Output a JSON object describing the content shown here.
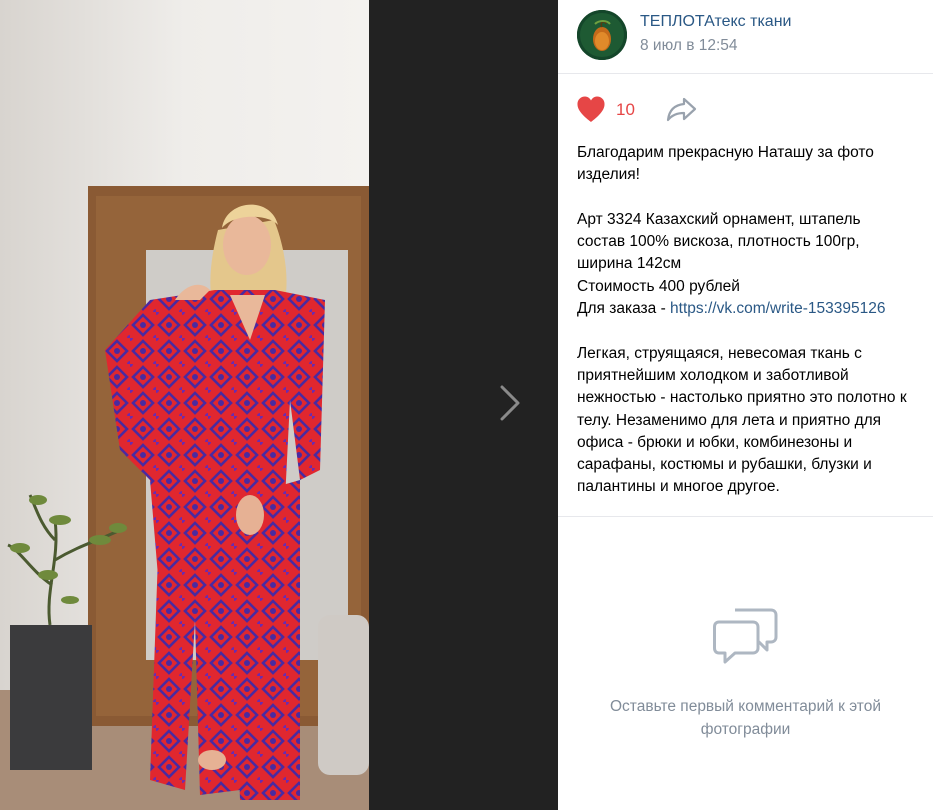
{
  "post": {
    "author": "ТЕПЛОТАтекс ткани",
    "date": "8 июл в 12:54",
    "likes": "10",
    "paragraphs": [
      [
        "Благодарим прекрасную Наташу за фото изделия!"
      ],
      [
        "Арт 3324 Казахский орнамент, штапель",
        "состав 100% вискоза, плотность 100гр,",
        "ширина 142см",
        "Стоимость 400 рублей"
      ],
      [
        "Легкая, струящаяся, невесомая ткань с приятнейшим холодком и заботливой нежностью - настолько приятно это полотно к телу. Незаменимо для лета и приятно для офиса - брюки и юбки, комбинезоны и сарафаны, костюмы и рубашки, блузки и палантины и многое другое."
      ]
    ],
    "order_label": "Для заказа - ",
    "order_link": "https://vk.com/write-153395126"
  },
  "comments": {
    "empty_text": "Оставьте первый комментарий к этой фотографии"
  },
  "icons": {
    "next": "chevron-right-icon",
    "like": "heart-icon",
    "share": "share-icon",
    "comments": "comments-icon"
  },
  "colors": {
    "link": "#2a5885",
    "like": "#e64646",
    "muted": "#818c99",
    "viewer_bg": "#222222"
  }
}
